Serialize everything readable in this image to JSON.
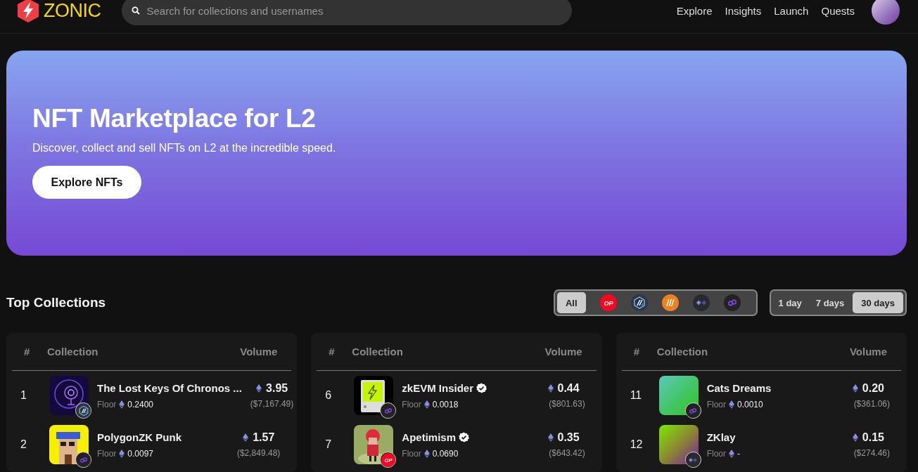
{
  "header": {
    "logo_text": "ZONIC",
    "search": {
      "placeholder": "Search for collections and usernames"
    },
    "nav": [
      "Explore",
      "Insights",
      "Launch",
      "Quests"
    ]
  },
  "hero": {
    "title": "NFT Marketplace for L2",
    "subtitle": "Discover, collect and sell NFTs on L2 at the incredible speed.",
    "button": "Explore NFTs"
  },
  "top_collections": {
    "title": "Top Collections",
    "networks": [
      {
        "kind": "all",
        "label": "All",
        "selected": true
      },
      {
        "kind": "op",
        "label": "OP",
        "selected": false
      },
      {
        "kind": "arbitrum",
        "selected": false
      },
      {
        "kind": "nova",
        "selected": false
      },
      {
        "kind": "zksync",
        "selected": false
      },
      {
        "kind": "polygon",
        "selected": false
      }
    ],
    "periods": [
      {
        "label": "1 day",
        "selected": false
      },
      {
        "label": "7 days",
        "selected": false
      },
      {
        "label": "30 days",
        "selected": true
      }
    ],
    "tables": [
      {
        "columns": [
          "#",
          "Collection",
          "Volume"
        ],
        "rows": [
          {
            "rank": "1",
            "name": "The Lost Keys Of Chronos ...",
            "verified": false,
            "floor_label": "Floor",
            "floor": "0.2400",
            "volume": "3.95",
            "volume_usd": "($7,167.49)",
            "chain": {
              "kind": "arbitrum"
            }
          },
          {
            "rank": "2",
            "name": "PolygonZK Punk",
            "verified": false,
            "floor_label": "Floor",
            "floor": "0.0097",
            "volume": "1.57",
            "volume_usd": "($2,849.48)",
            "chain": {
              "kind": "polygon"
            }
          }
        ]
      },
      {
        "columns": [
          "#",
          "Collection",
          "Volume"
        ],
        "rows": [
          {
            "rank": "6",
            "name": "zkEVM Insider",
            "verified": true,
            "floor_label": "Floor",
            "floor": "0.0018",
            "volume": "0.44",
            "volume_usd": "($801.63)",
            "chain": {
              "kind": "polygon"
            }
          },
          {
            "rank": "7",
            "name": "Apetimism",
            "verified": true,
            "floor_label": "Floor",
            "floor": "0.0690",
            "volume": "0.35",
            "volume_usd": "($643.42)",
            "chain": {
              "kind": "op",
              "label": "OP"
            }
          }
        ]
      },
      {
        "columns": [
          "#",
          "Collection",
          "Volume"
        ],
        "rows": [
          {
            "rank": "11",
            "name": "Cats Dreams",
            "verified": false,
            "floor_label": "Floor",
            "floor": "0.0010",
            "volume": "0.20",
            "volume_usd": "($361.06)",
            "chain": {
              "kind": "polygon"
            }
          },
          {
            "rank": "12",
            "name": "ZKlay",
            "verified": false,
            "floor_label": "Floor",
            "floor": "-",
            "volume": "0.15",
            "volume_usd": "($274.46)",
            "chain": {
              "kind": "zksync"
            }
          }
        ]
      }
    ]
  }
}
